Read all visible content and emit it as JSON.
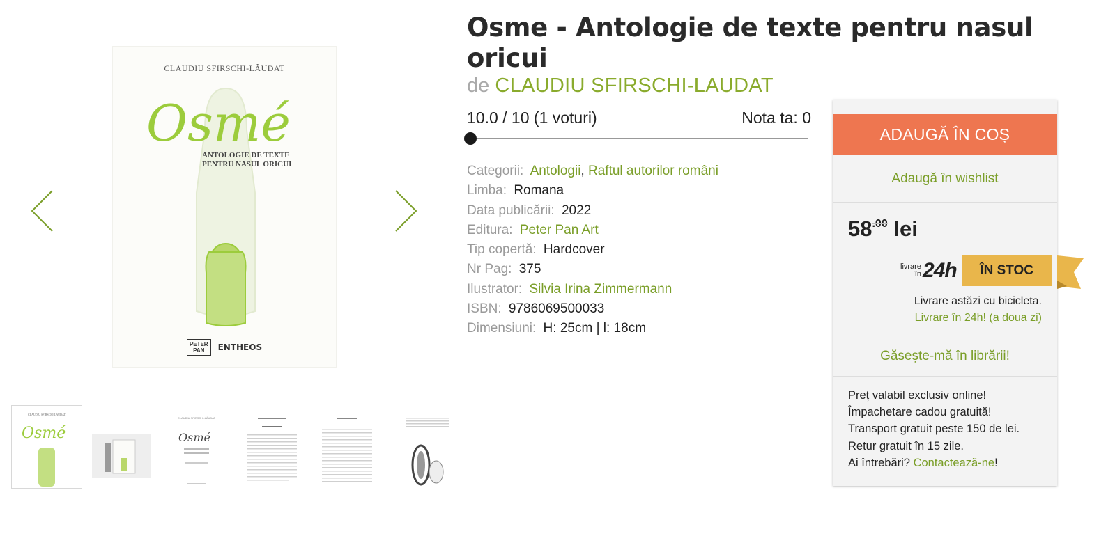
{
  "product": {
    "title": "Osme - Antologie de texte pentru nasul oricui",
    "author_prefix": "de",
    "author": "CLAUDIU SFIRSCHI-LAUDAT"
  },
  "cover": {
    "author": "CLAUDIU SFIRSCHI-LÂUDAT",
    "title": "Osmé",
    "subtitle_line1": "ANTOLOGIE DE TEXTE",
    "subtitle_line2": "PENTRU NASUL ORICUI",
    "publisher1_line1": "PETER",
    "publisher1_line2": "PAN",
    "publisher2": "ENTHEOS"
  },
  "gallery": {
    "prev_icon": "chevron-left-icon",
    "next_icon": "chevron-right-icon",
    "thumbnail_count": 6
  },
  "rating": {
    "score": "10.0 / 10 (1 voturi)",
    "user_rating": "Nota ta: 0",
    "user_rating_value": 0
  },
  "details": {
    "categories_label": "Categorii:",
    "categories": [
      "Antologii",
      "Raftul autorilor români"
    ],
    "categories_separator": ",",
    "language_label": "Limba:",
    "language": "Romana",
    "pub_date_label": "Data publicării:",
    "pub_date": "2022",
    "publisher_label": "Editura:",
    "publisher": "Peter Pan Art",
    "cover_type_label": "Tip copertă:",
    "cover_type": "Hardcover",
    "pages_label": "Nr Pag:",
    "pages": "375",
    "illustrator_label": "Ilustrator:",
    "illustrator": "Silvia Irina Zimmermann",
    "isbn_label": "ISBN:",
    "isbn": "9786069500033",
    "dimensions_label": "Dimensiuni:",
    "dimensions": "H: 25cm | l: 18cm"
  },
  "buybox": {
    "add_to_cart": "ADAUGĂ ÎN COȘ",
    "wishlist": "Adaugă în wishlist",
    "price_int": "58",
    "price_dec": ".00",
    "currency": "lei",
    "livrare_small_1": "livrare",
    "livrare_small_2": "în",
    "livrare_big": "24h",
    "stock": "ÎN STOC",
    "delivery_today": "Livrare astăzi cu bicicleta.",
    "delivery_24h": "Livrare în 24h! (a doua zi)",
    "find_store": "Găsește-mă în librării!",
    "perks": [
      "Preț valabil exclusiv online!",
      "Împachetare cadou gratuită!",
      "Transport gratuit peste 150 de lei.",
      "Retur gratuit în 15 zile."
    ],
    "questions_prefix": "Ai întrebări?",
    "contact_link": "Contactează-ne",
    "questions_suffix": "!"
  },
  "colors": {
    "accent_green": "#7a9e28",
    "cart_orange": "#ee7650",
    "stock_gold": "#e9b64b"
  }
}
